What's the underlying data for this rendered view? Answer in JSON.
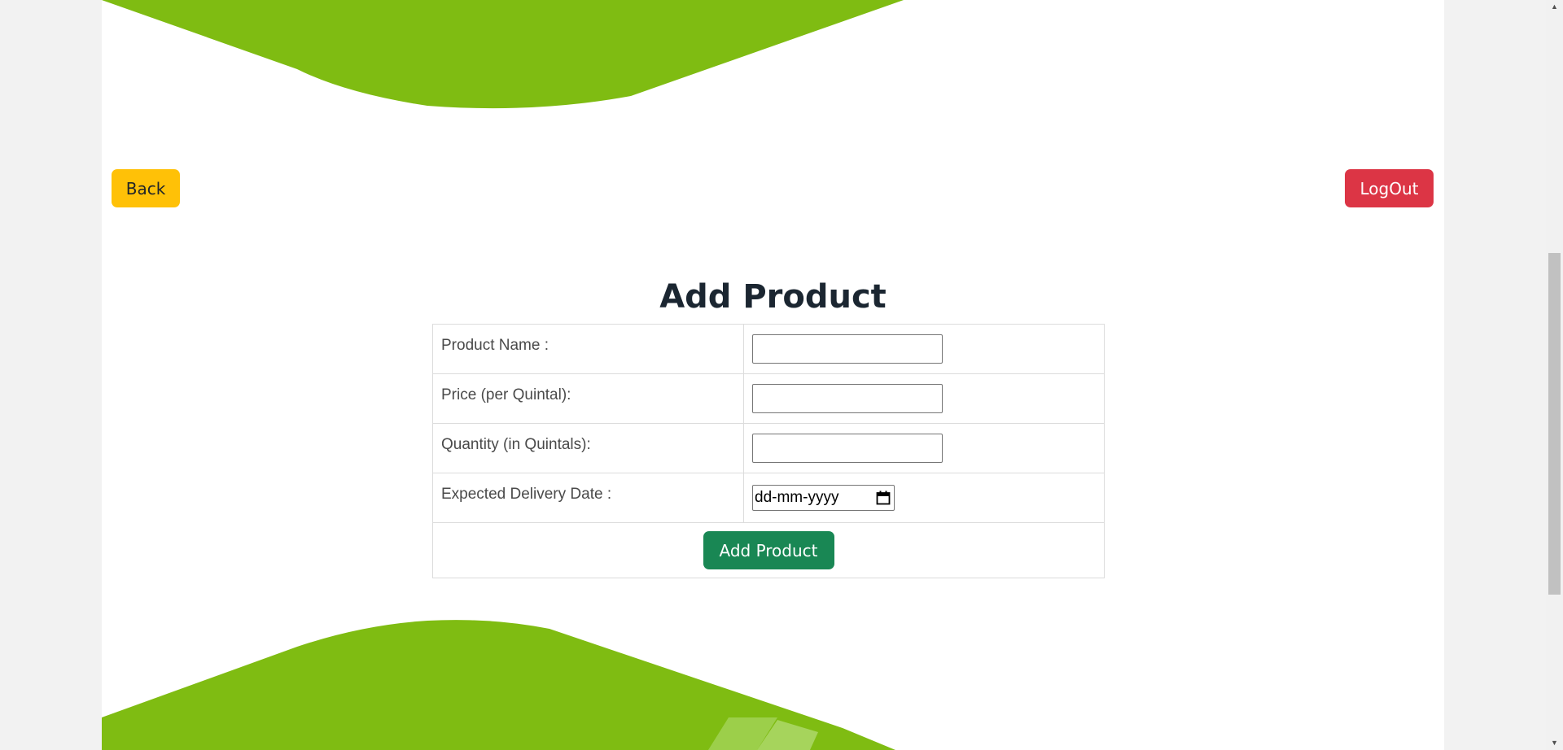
{
  "header": {
    "back_label": "Back",
    "logout_label": "LogOut"
  },
  "form": {
    "title": "Add Product",
    "fields": [
      {
        "label": "Product Name :",
        "value": ""
      },
      {
        "label": "Price (per Quintal):",
        "value": ""
      },
      {
        "label": "Quantity (in Quintals):",
        "value": ""
      },
      {
        "label": "Expected Delivery Date :",
        "placeholder": "dd-mm-yyyy"
      }
    ],
    "submit_label": "Add Product"
  },
  "scroll_top_icon": "arrow-up-icon",
  "colors": {
    "wave_green": "#7fbc12",
    "back_button": "#ffc107",
    "logout_button": "#dc3545",
    "submit_button": "#198754",
    "scroll_top_button": "#ff0000",
    "title": "#1b2631"
  }
}
